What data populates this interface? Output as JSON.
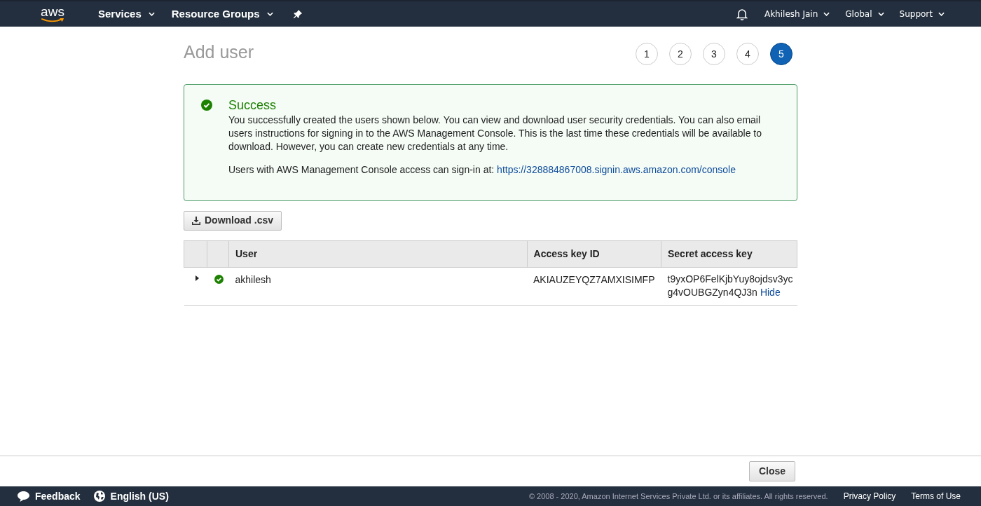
{
  "nav": {
    "logo": "aws",
    "menus": [
      {
        "label": "Services"
      },
      {
        "label": "Resource Groups"
      }
    ],
    "right_menus": [
      {
        "label": "Akhilesh Jain"
      },
      {
        "label": "Global"
      },
      {
        "label": "Support"
      }
    ]
  },
  "page": {
    "title": "Add user",
    "steps": [
      {
        "label": "1",
        "selected": false
      },
      {
        "label": "2",
        "selected": false
      },
      {
        "label": "3",
        "selected": false
      },
      {
        "label": "4",
        "selected": false
      },
      {
        "label": "5",
        "selected": true
      }
    ]
  },
  "alert": {
    "title": "Success",
    "message": "You successfully created the users shown below. You can view and download user security credentials. You can also email users instructions for signing in to the AWS Management Console. This is the last time these credentials will be available to download. However, you can create new credentials at any time.",
    "signin_text": "Users with AWS Management Console access can sign-in at:",
    "signin_link": "https://328884867008.signin.aws.amazon.com/console"
  },
  "download_button": "Download .csv",
  "table": {
    "columns": [
      "User",
      "Access key ID",
      "Secret access key"
    ],
    "rows": [
      {
        "expanded": false,
        "succeeded": true,
        "user": "akhilesh",
        "access_key_id": "AKIAUZEYQZ7AMXISIMFP",
        "secret_access_key_lines": [
          "t9yxOP6FelKjbYuy8ojdsv3yc",
          "g4vOUBGZyn4QJ3n"
        ],
        "secret_action": "Hide"
      }
    ]
  },
  "close_button": "Close",
  "footer": {
    "feedback": "Feedback",
    "language": "English (US)",
    "copyright": "© 2008 - 2020, Amazon Internet Services Private Ltd. or its affiliates. All rights reserved.",
    "links": [
      "Privacy Policy",
      "Terms of Use"
    ]
  }
}
